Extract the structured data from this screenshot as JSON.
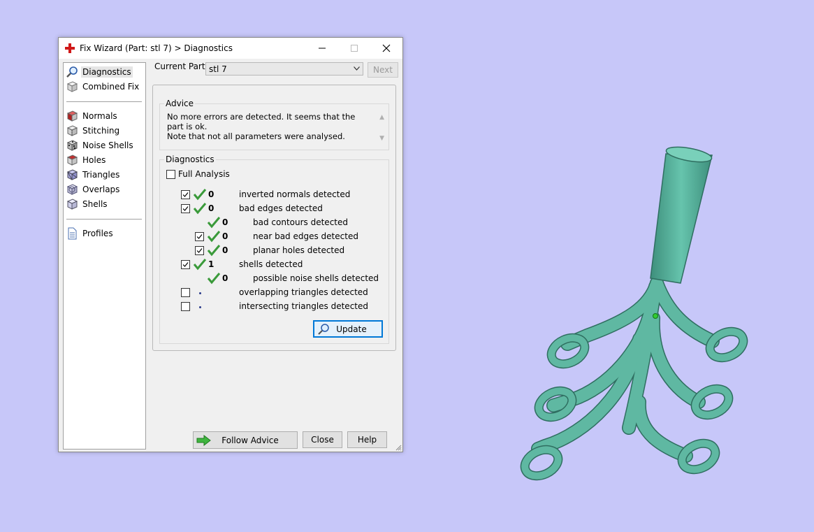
{
  "window": {
    "title": "Fix Wizard (Part: stl 7) > Diagnostics"
  },
  "sidebar": {
    "items": [
      {
        "label": "Diagnostics",
        "icon": "magnifier-icon"
      },
      {
        "label": "Combined Fix",
        "icon": "cube-icon"
      },
      {
        "label": "Normals",
        "icon": "normals-cube-icon"
      },
      {
        "label": "Stitching",
        "icon": "stitching-cube-icon"
      },
      {
        "label": "Noise Shells",
        "icon": "noise-shells-icon"
      },
      {
        "label": "Holes",
        "icon": "holes-cube-icon"
      },
      {
        "label": "Triangles",
        "icon": "triangles-cube-icon"
      },
      {
        "label": "Overlaps",
        "icon": "overlaps-cube-icon"
      },
      {
        "label": "Shells",
        "icon": "shells-cube-icon"
      },
      {
        "label": "Profiles",
        "icon": "document-icon"
      }
    ]
  },
  "header": {
    "current_part_label": "Current Part:",
    "current_part_value": "stl 7",
    "next_label": "Next"
  },
  "advice": {
    "title": "Advice",
    "line1": "No more errors are detected. It seems that the part is ok.",
    "line2": "Note that not all parameters were analysed."
  },
  "diagnostics": {
    "title": "Diagnostics",
    "full_analysis_label": "Full Analysis",
    "rows": [
      {
        "count": "0",
        "label": "inverted normals detected"
      },
      {
        "count": "0",
        "label": "bad edges detected"
      },
      {
        "count": "0",
        "label": "bad contours detected"
      },
      {
        "count": "0",
        "label": "near bad edges detected"
      },
      {
        "count": "0",
        "label": "planar holes detected"
      },
      {
        "count": "1",
        "label": "shells detected"
      },
      {
        "count": "0",
        "label": "possible noise shells detected"
      },
      {
        "count": "",
        "label": "overlapping triangles detected"
      },
      {
        "count": "",
        "label": "intersecting triangles detected"
      }
    ],
    "update_label": "Update"
  },
  "footer": {
    "follow_advice_label": "Follow Advice",
    "close_label": "Close",
    "help_label": "Help"
  },
  "colors": {
    "background": "#c7c7f9",
    "model": "#5fb8a2",
    "check_green": "#3a9a3a",
    "accent": "#0078d7"
  }
}
